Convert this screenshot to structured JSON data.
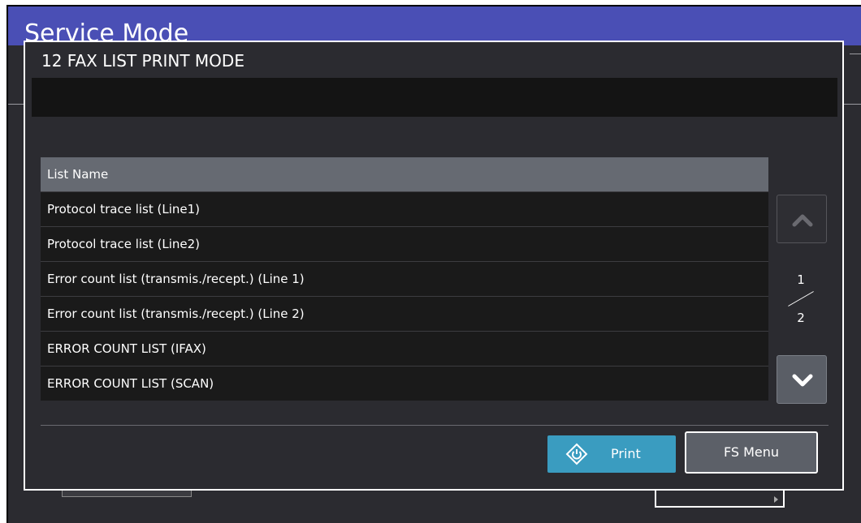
{
  "screen": {
    "title": "Service Mode"
  },
  "dialog": {
    "title": "12 FAX LIST PRINT MODE",
    "message": ""
  },
  "list": {
    "header": "List Name",
    "rows": [
      "Protocol trace list (Line1)",
      "Protocol trace list (Line2)",
      "Error count list (transmis./recept.) (Line 1)",
      "Error count list (transmis./recept.) (Line 2)",
      "ERROR COUNT LIST (IFAX)",
      "ERROR COUNT LIST (SCAN)"
    ]
  },
  "pager": {
    "current": "1",
    "total": "2",
    "up_icon": "chevron-up-icon",
    "down_icon": "chevron-down-icon"
  },
  "footer": {
    "print_label": "Print",
    "print_icon": "start-diamond-icon",
    "fs_menu_label": "FS Menu"
  },
  "colors": {
    "title_bar": "#4a4fb5",
    "print_button": "#3a9cc0",
    "panel_background": "#2b2b30"
  }
}
